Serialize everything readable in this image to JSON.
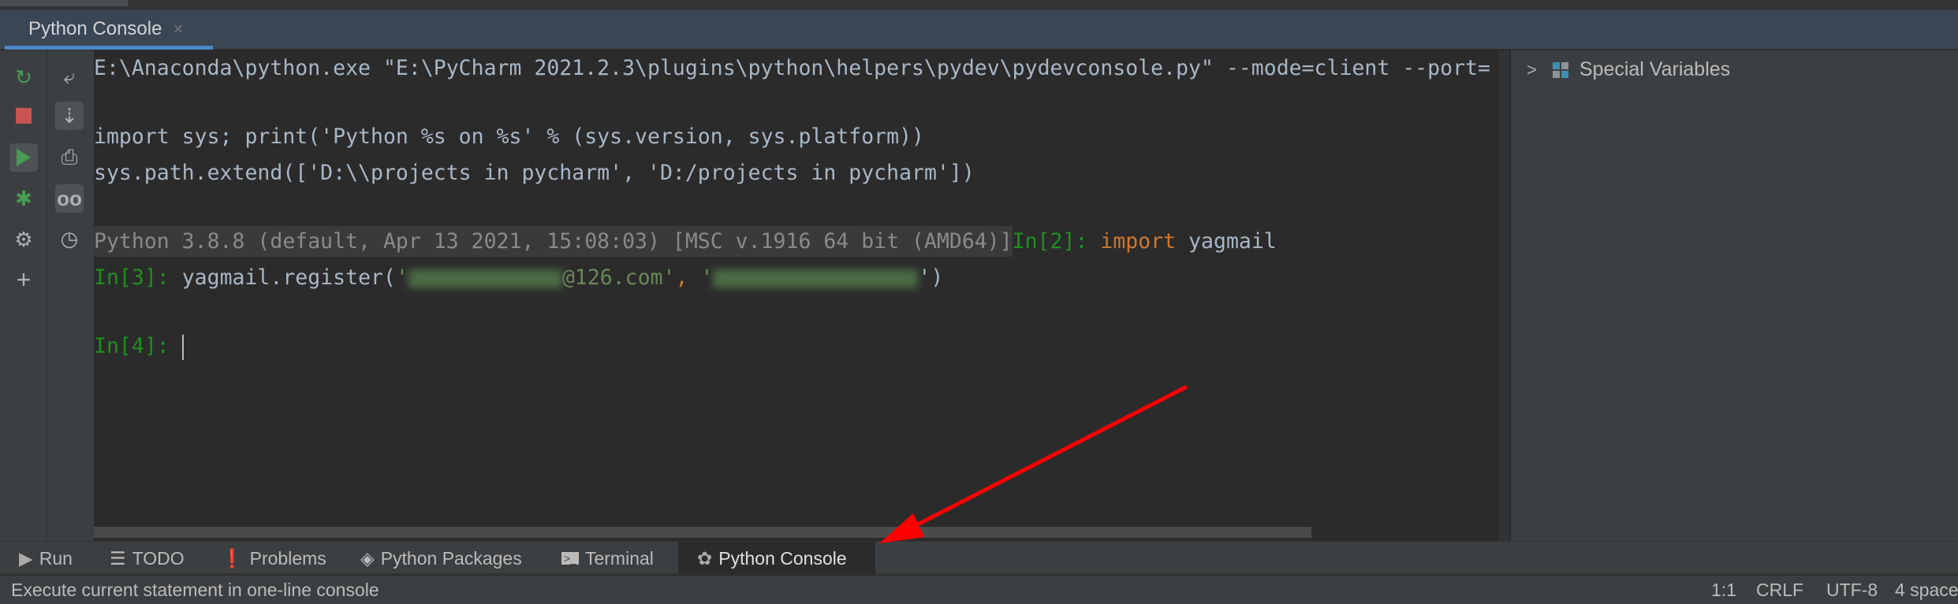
{
  "tab": {
    "title": "Python Console",
    "close": "×"
  },
  "left_toolbar": {
    "icons": [
      "rerun-icon",
      "stop-icon",
      "run-icon",
      "debug-icon",
      "settings-icon",
      "add-icon"
    ],
    "colors": {
      "rerun": "#499c54",
      "stop": "#c75450",
      "run": "#499c54"
    }
  },
  "side_toolbar": {
    "icons": [
      "soft-wrap-icon",
      "scroll-to-end-icon",
      "print-icon",
      "show-variables-icon",
      "history-icon"
    ]
  },
  "console": {
    "line1": "E:\\Anaconda\\python.exe \"E:\\PyCharm 2021.2.3\\plugins\\python\\helpers\\pydev\\pydevconsole.py\" --mode=client --port=",
    "line2": "import sys; print('Python %s on %s' % (sys.version, sys.platform))",
    "line3": "sys.path.extend(['D:\\\\projects in pycharm', 'D:/projects in pycharm'])",
    "banner": "Python 3.8.8 (default, Apr 13 2021, 15:08:03) [MSC v.1916 64 bit (AMD64)]",
    "prompt2": "In[2]:",
    "kw_import": "import",
    "mod": "yagmail",
    "prompt3": "In[3]:",
    "call": "yagmail.register(",
    "q1": "'",
    "email_suffix": "@126.com'",
    "comma": ", ",
    "q2": "'",
    "close": "')",
    "prompt4": "In[4]:"
  },
  "variables": {
    "special": "Special Variables"
  },
  "tool_windows": [
    {
      "label": "Run",
      "icon": "run-icon"
    },
    {
      "label": "TODO",
      "icon": "list-icon"
    },
    {
      "label": "Problems",
      "icon": "problems-icon"
    },
    {
      "label": "Python Packages",
      "icon": "packages-icon"
    },
    {
      "label": "Terminal",
      "icon": "terminal-icon"
    },
    {
      "label": "Python Console",
      "icon": "python-icon",
      "active": true
    }
  ],
  "status": {
    "message": "Execute current statement in one-line console",
    "position": "1:1",
    "line_sep": "CRLF",
    "encoding": "UTF-8",
    "indent": "4 space"
  },
  "annotation": {
    "arrow_color": "#ff0000"
  }
}
